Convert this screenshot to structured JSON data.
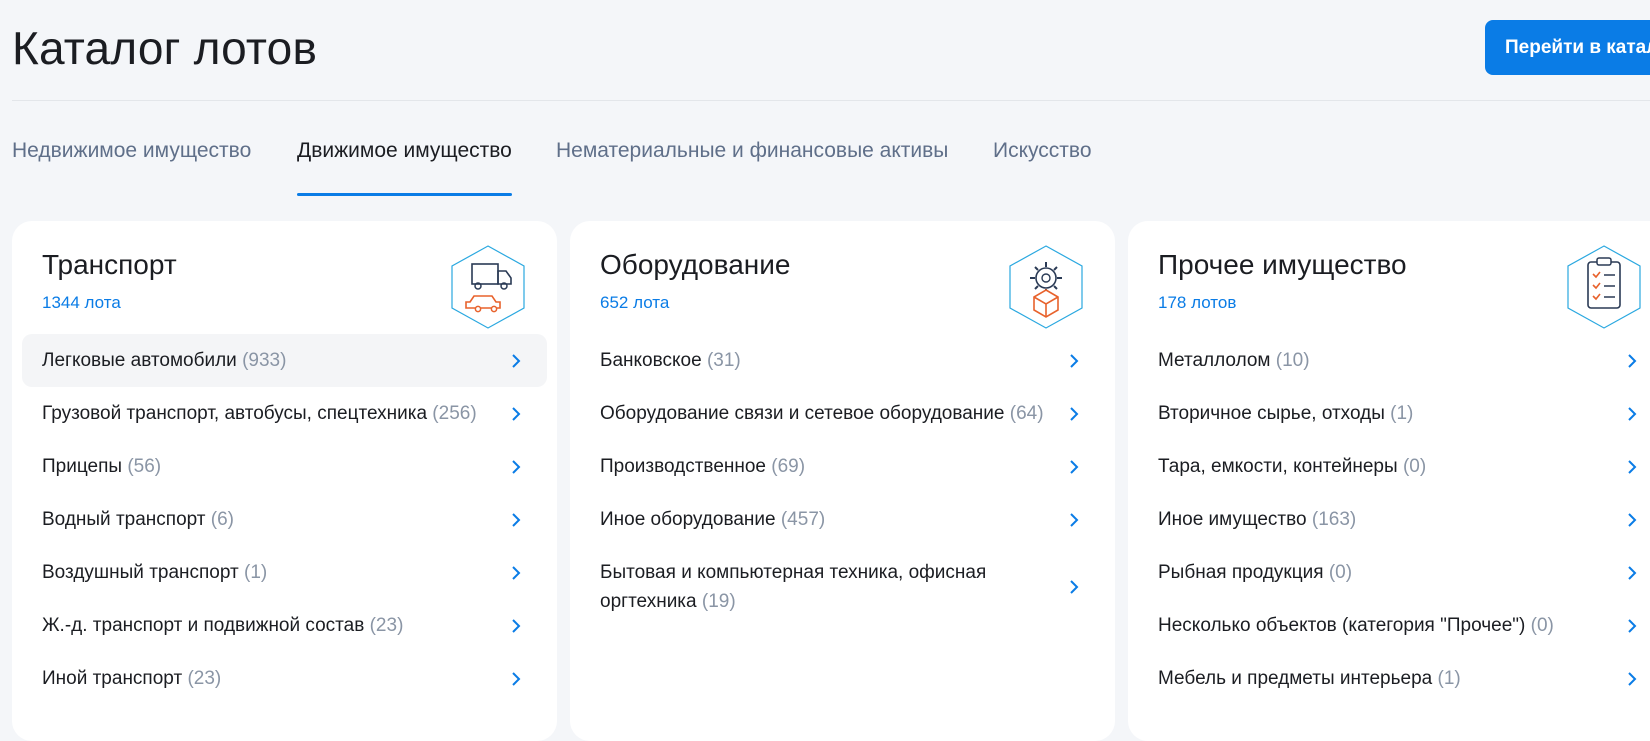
{
  "header": {
    "title": "Каталог лотов",
    "button_label": "Перейти  в каталог"
  },
  "tabs": [
    {
      "label": "Недвижимое имущество",
      "active": false
    },
    {
      "label": "Движимое имущество",
      "active": true
    },
    {
      "label": "Нематериальные и финансовые активы",
      "active": false
    },
    {
      "label": "Искусство",
      "active": false
    }
  ],
  "colors": {
    "accent": "#0a7ce6",
    "background": "#f4f6f9",
    "icon_orange": "#e8622c",
    "count_gray": "#8a95a5",
    "tab_inactive": "#5f6f89"
  },
  "cards": [
    {
      "title": "Транспорт",
      "count": "1344 лота",
      "icon": "truck-car-icon",
      "items": [
        {
          "label": "Легковые автомобили",
          "count": "(933)"
        },
        {
          "label": "Грузовой транспорт, автобусы, спецтехника",
          "count": "(256)"
        },
        {
          "label": "Прицепы",
          "count": "(56)"
        },
        {
          "label": "Водный транспорт",
          "count": "(6)"
        },
        {
          "label": "Воздушный транспорт",
          "count": "(1)"
        },
        {
          "label": "Ж.-д. транспорт и подвижной состав",
          "count": "(23)"
        },
        {
          "label": "Иной транспорт",
          "count": "(23)"
        }
      ]
    },
    {
      "title": "Оборудование",
      "count": "652 лота",
      "icon": "gear-box-icon",
      "items": [
        {
          "label": "Банковское",
          "count": "(31)"
        },
        {
          "label": "Оборудование связи и сетевое оборудование",
          "count": "(64)"
        },
        {
          "label": "Производственное",
          "count": "(69)"
        },
        {
          "label": "Иное оборудование",
          "count": "(457)"
        },
        {
          "label": "Бытовая и компьютерная техника, офисная оргтехника",
          "count": "(19)"
        }
      ]
    },
    {
      "title": "Прочее имущество",
      "count": "178 лотов",
      "icon": "clipboard-checklist-icon",
      "items": [
        {
          "label": "Металлолом",
          "count": "(10)"
        },
        {
          "label": "Вторичное сырье, отходы",
          "count": "(1)"
        },
        {
          "label": "Тара, емкости, контейнеры",
          "count": "(0)"
        },
        {
          "label": "Иное имущество",
          "count": "(163)"
        },
        {
          "label": "Рыбная продукция",
          "count": "(0)"
        },
        {
          "label": "Несколько объектов (категория \"Прочее\")",
          "count": "(0)"
        },
        {
          "label": "Мебель и предметы интерьера",
          "count": "(1)"
        }
      ]
    }
  ]
}
